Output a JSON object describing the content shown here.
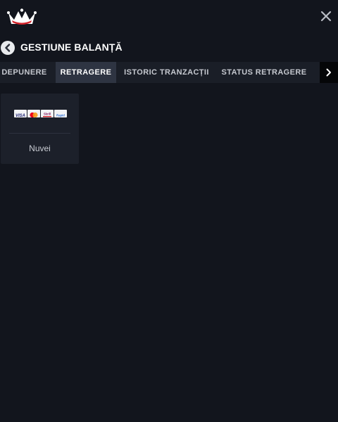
{
  "header": {
    "title": "GESTIUNE BALANȚĂ",
    "logo_icon": "crown-logo-icon",
    "close_icon": "close-icon",
    "back_icon": "chevron-left-icon"
  },
  "tabs": [
    {
      "label": "DEPUNERE",
      "active": false
    },
    {
      "label": "RETRAGERE",
      "active": true
    },
    {
      "label": "ISTORIC TRANZACȚII",
      "active": false
    },
    {
      "label": "STATUS RETRAGERE",
      "active": false
    }
  ],
  "tabs_next_icon": "chevron-right-icon",
  "payment_methods": [
    {
      "label": "Nuvei",
      "logos": [
        "VISA",
        "mastercard",
        "Skrill",
        "Rapid"
      ]
    }
  ],
  "colors": {
    "background": "#12151d",
    "tab_bar": "#1a1e27",
    "tab_active": "#2e3442",
    "card": "#1c202a",
    "brand_red": "#d2232a"
  }
}
